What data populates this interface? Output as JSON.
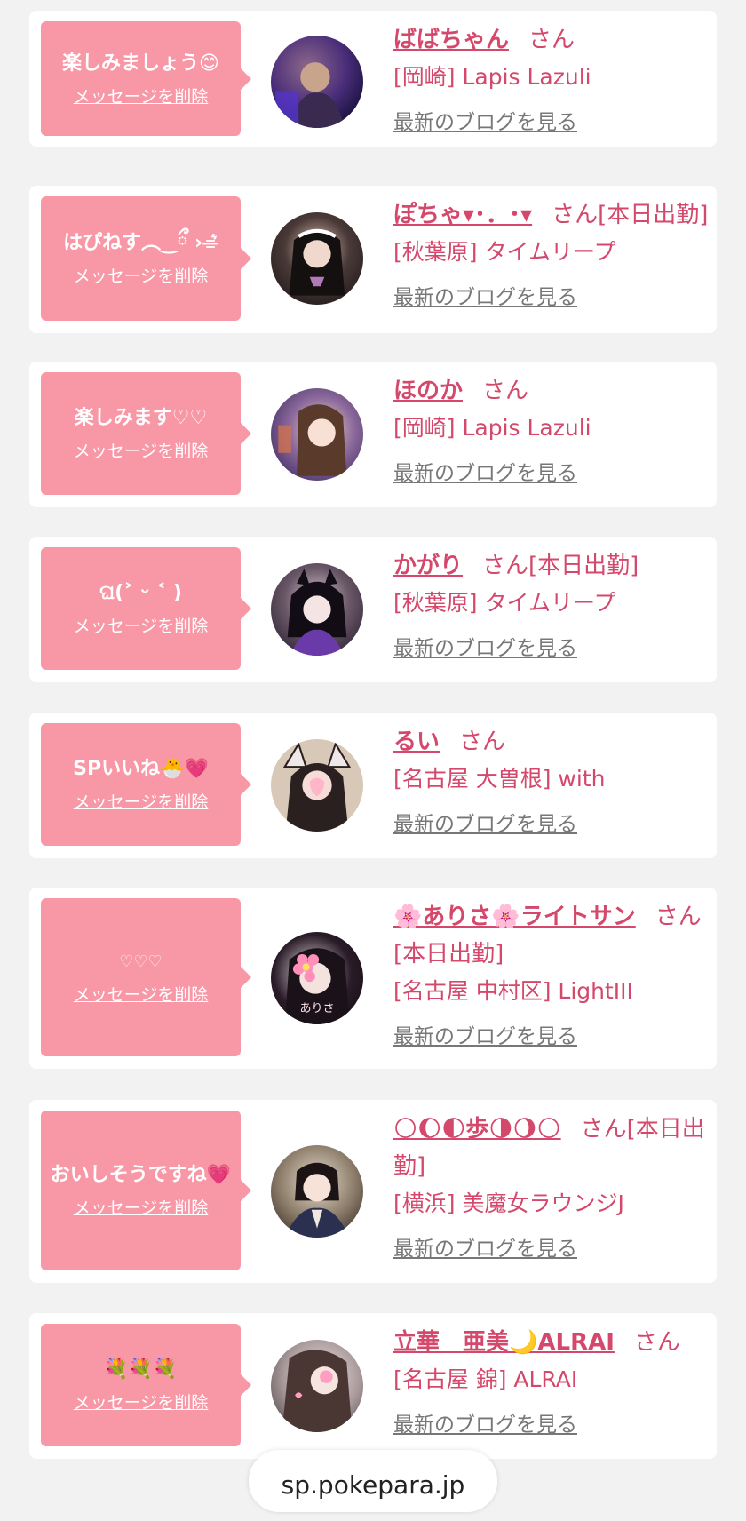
{
  "delete_label": "メッセージを削除",
  "blog_label": "最新のブログを見る",
  "honorific": "さん",
  "url_bar": "sp.pokepara.jp",
  "colors": {
    "bubble": "#f898a7",
    "accent": "#d4486c",
    "background": "#f3f2f2"
  },
  "entries": [
    {
      "message": "楽しみましょう😊",
      "name": "ばばちゃん",
      "status": "",
      "shop": "[岡崎] Lapis Lazuli",
      "avatar": "avatar-photo"
    },
    {
      "message": "はぴねす︵‿ྀ ›⌯͛",
      "name": "ぽちゃ▾･．･▾",
      "status": "[本日出勤]",
      "shop": "[秋葉原] タイムリープ",
      "avatar": "avatar-photo"
    },
    {
      "message": "楽しみます♡♡",
      "name": "ほのか",
      "status": "",
      "shop": "[岡崎] Lapis Lazuli",
      "avatar": "avatar-photo"
    },
    {
      "message": "ଘ(˃ ᵕ ˂ )",
      "name": "かがり",
      "status": "[本日出勤]",
      "shop": "[秋葉原] タイムリープ",
      "avatar": "avatar-photo"
    },
    {
      "message": "SPいいね🐣💗",
      "name": "るい",
      "status": "",
      "shop": "[名古屋 大曽根] with",
      "avatar": "avatar-photo"
    },
    {
      "message": "♡♡♡",
      "name": "🌸ありさ🌸ライトサン",
      "status": "[本日出勤]",
      "shop": "[名古屋 中村区] LightIII",
      "avatar": "avatar-photo",
      "avatar_caption": "ありさ"
    },
    {
      "message": "おいしそうですね💗",
      "name": "🌕🌔🌓歩🌗🌖🌕",
      "status": "[本日出勤]",
      "shop": "[横浜] 美魔女ラウンジJ",
      "avatar": "avatar-photo"
    },
    {
      "message": "💐💐💐",
      "name": "立華　亜美🌙ALRAI",
      "status": "",
      "shop": "[名古屋 錦] ALRAI",
      "avatar": "avatar-photo"
    }
  ]
}
